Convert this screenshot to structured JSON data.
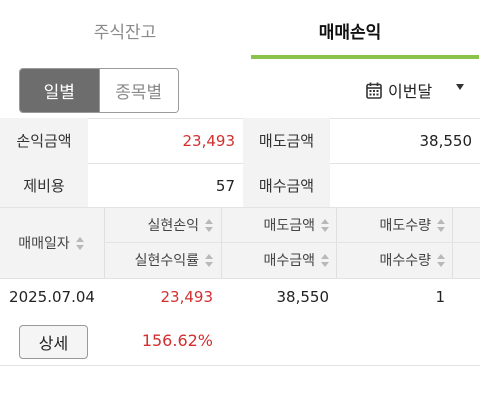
{
  "tabs": [
    {
      "label": "주식잔고",
      "active": false
    },
    {
      "label": "매매손익",
      "active": true
    }
  ],
  "accent_color": "#8bc34a",
  "segment": {
    "daily": "일별",
    "by_stock": "종목별",
    "selected": "일별"
  },
  "period": {
    "label": "이번달",
    "icon": "calendar-icon"
  },
  "summary": {
    "profit_label": "손익금액",
    "profit_value": "23,493",
    "sell_label": "매도금액",
    "sell_value": "38,550",
    "fee_label": "제비용",
    "fee_value": "57",
    "buy_label": "매수금액",
    "buy_value": ""
  },
  "table": {
    "headers": {
      "date": "매매일자",
      "realized_pl": "실현손익",
      "realized_rate": "실현수익률",
      "sell_amount": "매도금액",
      "buy_amount": "매수금액",
      "sell_qty": "매도수량",
      "buy_qty": "매수수량"
    },
    "rows": [
      {
        "date": "2025.07.04",
        "realized_pl": "23,493",
        "realized_rate": "156.62%",
        "sell_amount": "38,550",
        "buy_amount": "",
        "sell_qty": "1",
        "buy_qty": "",
        "detail_label": "상세"
      }
    ]
  },
  "negative_positive_color": "#d32f2f"
}
